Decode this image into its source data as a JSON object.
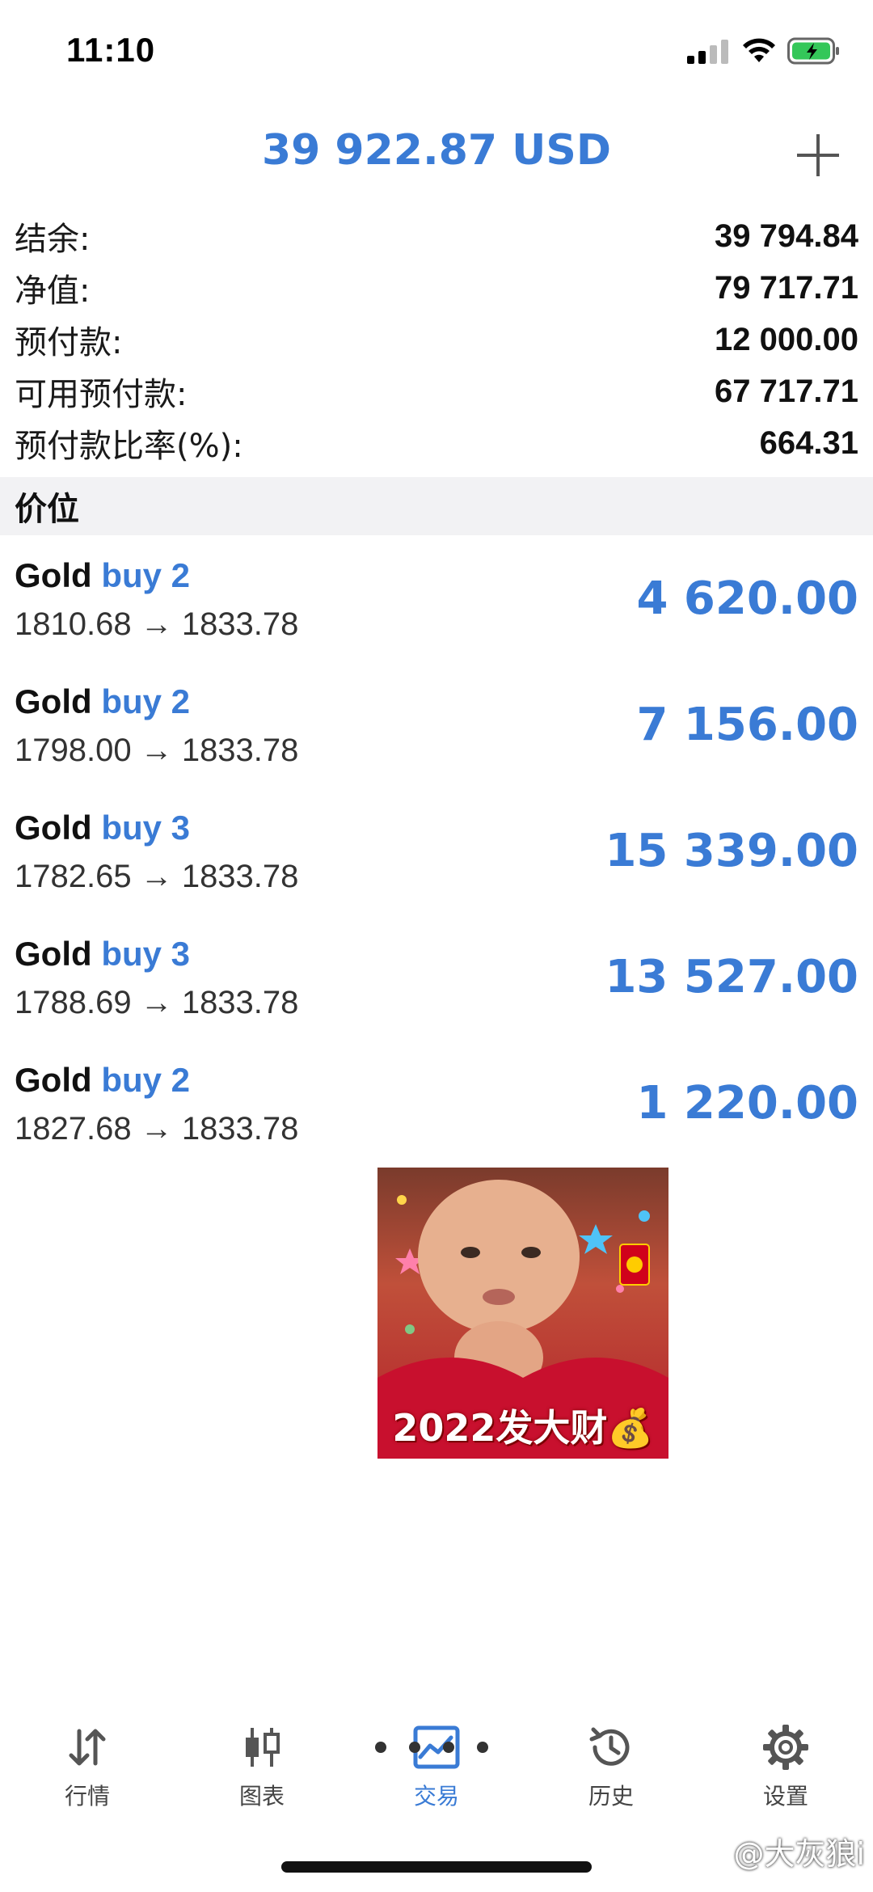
{
  "status_bar": {
    "time": "11:10"
  },
  "header": {
    "title": "39 922.87 USD",
    "add_icon": "plus-icon"
  },
  "summary": [
    {
      "label": "结余:",
      "value": "39 794.84"
    },
    {
      "label": "净值:",
      "value": "79 717.71"
    },
    {
      "label": "预付款:",
      "value": "12 000.00"
    },
    {
      "label": "可用预付款:",
      "value": "67 717.71"
    },
    {
      "label": "预付款比率(%):",
      "value": "664.31"
    }
  ],
  "section": {
    "title": "价位"
  },
  "positions": [
    {
      "symbol": "Gold",
      "side": "buy 2",
      "prices": "1810.68 → 1833.78",
      "profit": "4 620.00"
    },
    {
      "symbol": "Gold",
      "side": "buy 2",
      "prices": "1798.00 → 1833.78",
      "profit": "7 156.00"
    },
    {
      "symbol": "Gold",
      "side": "buy 3",
      "prices": "1782.65 → 1833.78",
      "profit": "15 339.00"
    },
    {
      "symbol": "Gold",
      "side": "buy 3",
      "prices": "1788.69 → 1833.78",
      "profit": "13 527.00"
    },
    {
      "symbol": "Gold",
      "side": "buy 2",
      "prices": "1827.68 → 1833.78",
      "profit": "1 220.00"
    }
  ],
  "sticker": {
    "caption": "2022发大财💰"
  },
  "tabs": [
    {
      "label": "行情",
      "icon": "quotes-arrows-icon",
      "active": false
    },
    {
      "label": "图表",
      "icon": "candlestick-chart-icon",
      "active": false
    },
    {
      "label": "交易",
      "icon": "trade-chart-icon",
      "active": true
    },
    {
      "label": "历史",
      "icon": "history-clock-icon",
      "active": false
    },
    {
      "label": "设置",
      "icon": "gear-icon",
      "active": false
    }
  ],
  "watermark": "@大灰狼i",
  "colors": {
    "accent": "#3a7bd5",
    "section_bg": "#f2f2f4",
    "battery": "#34c759"
  }
}
